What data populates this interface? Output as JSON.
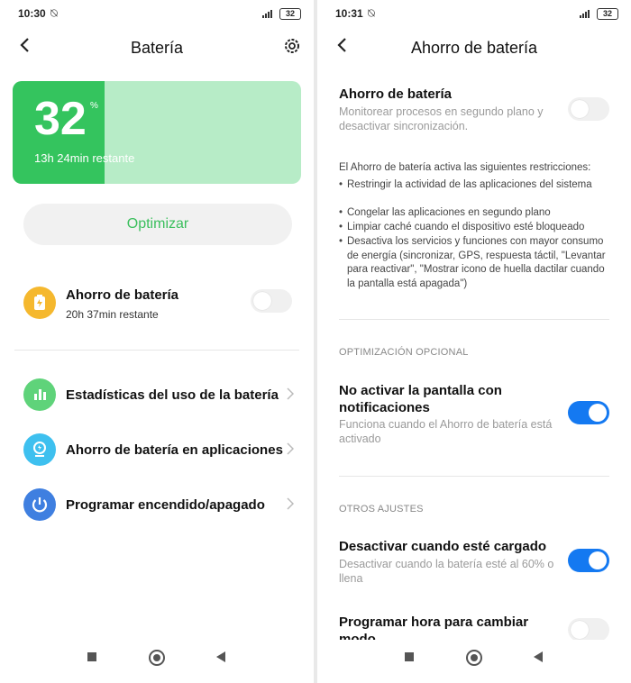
{
  "left": {
    "status": {
      "time": "10:30",
      "battery": "32"
    },
    "header": {
      "title": "Batería"
    },
    "battery_card": {
      "percent": "32",
      "percent_sign": "%",
      "remaining": "13h 24min restante",
      "level": 0.32
    },
    "optimize_button": "Optimizar",
    "saver": {
      "title": "Ahorro de batería",
      "subtitle": "20h 37min restante",
      "enabled": false
    },
    "menu": [
      {
        "label": "Estadísticas del uso de la batería"
      },
      {
        "label": "Ahorro de batería en aplicaciones"
      },
      {
        "label": "Programar encendido/apagado"
      }
    ]
  },
  "right": {
    "status": {
      "time": "10:31",
      "battery": "32"
    },
    "header": {
      "title": "Ahorro de batería"
    },
    "saver": {
      "title": "Ahorro de batería",
      "subtitle": "Monitorear procesos en segundo plano y desactivar sincronización.",
      "enabled": false
    },
    "restrictions": {
      "intro": "El Ahorro de batería activa las siguientes restricciones:",
      "items": [
        "Restringir la actividad de las aplicaciones del sistema",
        "Congelar las aplicaciones en segundo plano",
        "Limpiar caché cuando el dispositivo esté bloqueado",
        "Desactiva los servicios y funciones con mayor consumo de energía (sincronizar, GPS, respuesta táctil, \"Levantar para reactivar\", \"Mostrar icono de huella dactilar cuando la pantalla está apagada\")"
      ]
    },
    "optional_section": "OPTIMIZACIÓN OPCIONAL",
    "no_screen": {
      "title": "No activar la pantalla con notificaciones",
      "subtitle": "Funciona cuando el Ahorro de batería está activado",
      "enabled": true
    },
    "other_section": "OTROS AJUSTES",
    "charged": {
      "title": "Desactivar cuando esté cargado",
      "subtitle": "Desactivar cuando la batería esté al 60% o llena",
      "enabled": true
    },
    "schedule": {
      "title": "Programar hora para cambiar modo",
      "enabled": false
    }
  },
  "colors": {
    "accent_green": "#34c45e",
    "card_light": "#b7ecc7",
    "toggle_on": "#1479f1",
    "saver_icon": "#f5b82e",
    "stats_icon": "#5fd37a",
    "apps_icon": "#3ec0ef",
    "schedule_icon": "#3f7fe0"
  },
  "icons": [
    "back-arrow-icon",
    "gear-icon",
    "battery-saver-icon",
    "bar-chart-icon",
    "app-saver-icon",
    "power-icon",
    "chevron-right-icon",
    "square-nav-icon",
    "home-nav-icon",
    "back-nav-icon"
  ]
}
